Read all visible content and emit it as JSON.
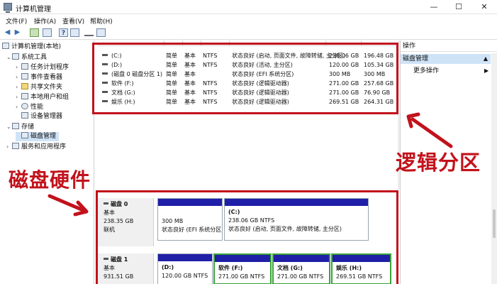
{
  "window": {
    "title": "计算机管理",
    "minimize": "—",
    "maximize": "☐",
    "close": "✕"
  },
  "menu": [
    "文件(F)",
    "操作(A)",
    "查看(V)",
    "帮助(H)"
  ],
  "toolbar": {
    "back": "◀",
    "forward": "▶",
    "help": "?"
  },
  "tree": {
    "root": "计算机管理(本地)",
    "system_tools": "系统工具",
    "task_scheduler": "任务计划程序",
    "event_viewer": "事件查看器",
    "shared_folders": "共享文件夹",
    "local_users": "本地用户和组",
    "performance": "性能",
    "device_manager": "设备管理器",
    "storage": "存储",
    "disk_management": "磁盘管理",
    "services": "服务和应用程序"
  },
  "volumes": [
    {
      "name": "(C:)",
      "layout": "简单",
      "type": "基本",
      "fs": "NTFS",
      "status": "状态良好 (启动, 页面文件, 故障转储, 主分区)",
      "capacity": "238.06 GB",
      "free": "196.48 GB"
    },
    {
      "name": "(D:)",
      "layout": "简单",
      "type": "基本",
      "fs": "NTFS",
      "status": "状态良好 (活动, 主分区)",
      "capacity": "120.00 GB",
      "free": "105.34 GB"
    },
    {
      "name": "(磁盘 0 磁盘分区 1)",
      "layout": "简单",
      "type": "基本",
      "fs": "",
      "status": "状态良好 (EFI 系统分区)",
      "capacity": "300 MB",
      "free": "300 MB"
    },
    {
      "name": "软件 (F:)",
      "layout": "简单",
      "type": "基本",
      "fs": "NTFS",
      "status": "状态良好 (逻辑驱动器)",
      "capacity": "271.00 GB",
      "free": "257.68 GB"
    },
    {
      "name": "文档 (G:)",
      "layout": "简单",
      "type": "基本",
      "fs": "NTFS",
      "status": "状态良好 (逻辑驱动器)",
      "capacity": "271.00 GB",
      "free": "76.90 GB"
    },
    {
      "name": "娱乐 (H:)",
      "layout": "简单",
      "type": "基本",
      "fs": "NTFS",
      "status": "状态良好 (逻辑驱动器)",
      "capacity": "269.51 GB",
      "free": "264.31 GB"
    }
  ],
  "actions": {
    "header": "操作",
    "group": "磁盘管理",
    "more": "更多操作",
    "caret_up": "▲",
    "caret_right": "▶"
  },
  "disks": [
    {
      "name": "磁盘 0",
      "type": "基本",
      "size": "238.35 GB",
      "state": "联机",
      "partitions": [
        {
          "label": "",
          "size": "300 MB",
          "status": "状态良好 (EFI 系统分区)"
        },
        {
          "label": "(C:)",
          "size": "238.06 GB NTFS",
          "status": "状态良好 (启动, 页面文件, 故障转储, 主分区)"
        }
      ]
    },
    {
      "name": "磁盘 1",
      "type": "基本",
      "size": "931.51 GB",
      "partitions": [
        {
          "label": "(D:)",
          "size": "120.00 GB NTFS"
        },
        {
          "label": "软件  (F:)",
          "size": "271.00 GB NTFS"
        },
        {
          "label": "文档  (G:)",
          "size": "271.00 GB NTFS"
        },
        {
          "label": "娱乐  (H:)",
          "size": "269.51 GB NTFS"
        }
      ]
    }
  ],
  "annotations": {
    "logical": "逻辑分区",
    "hardware": "磁盘硬件",
    "red": "#c2121b"
  }
}
